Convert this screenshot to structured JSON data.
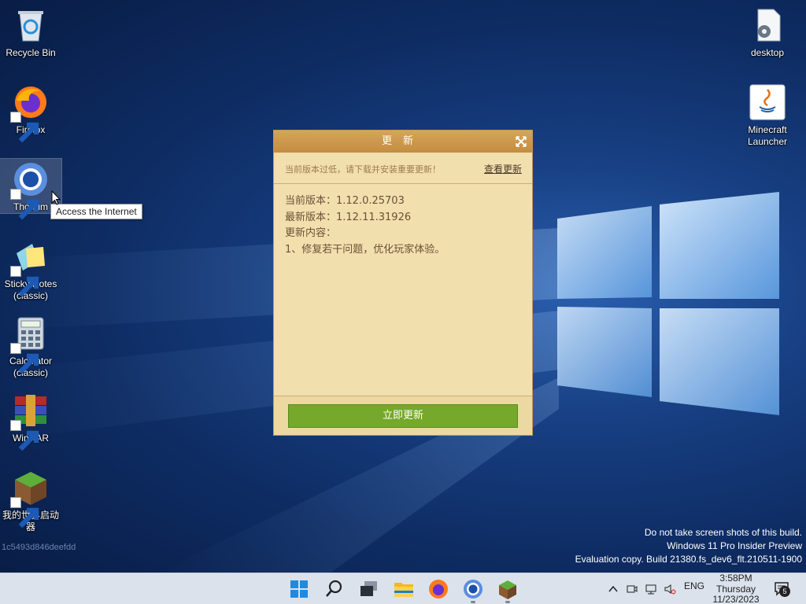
{
  "desktop": {
    "icons_left": [
      {
        "label": "Recycle Bin"
      },
      {
        "label": "Firefox"
      },
      {
        "label": "Thorium"
      },
      {
        "label": "Sticky Notes (classic)"
      },
      {
        "label": "Calculator (classic)"
      },
      {
        "label": "WinRAR"
      },
      {
        "label": "我的世界启动器"
      }
    ],
    "icons_right": [
      {
        "label": "desktop"
      },
      {
        "label": "Minecraft Launcher"
      }
    ],
    "tooltip": "Access the Internet",
    "hash_text": "1c5493d846deefdd"
  },
  "dialog": {
    "title": "更新",
    "notice": "当前版本过低，请下载并安装重要更新！",
    "view_link": "查看更新",
    "current_version": "当前版本：1.12.0.25703",
    "latest_version": "最新版本：1.12.11.31926",
    "content_label": "更新内容：",
    "content_item": "1、修复若干问题，优化玩家体验。",
    "update_button": "立即更新"
  },
  "watermark": {
    "line1": "Do not take screen shots of this build.",
    "line2": "Windows 11 Pro Insider Preview",
    "line3": "Evaluation copy. Build 21380.fs_dev6_flt.210511-1900"
  },
  "taskbar": {
    "apps": [
      "start-icon",
      "search-icon",
      "task-view-icon",
      "file-explorer-icon",
      "firefox-icon",
      "thorium-icon",
      "minecraft-icon"
    ],
    "language": "ENG",
    "time": "3:58PM",
    "day": "Thursday",
    "date": "11/23/2023",
    "notification_count": "5"
  },
  "colors": {
    "dialog_bg": "#f1dfae",
    "dialog_title": "#c48d42",
    "update_button": "#75a82b",
    "taskbar": "#dbe2ec"
  }
}
